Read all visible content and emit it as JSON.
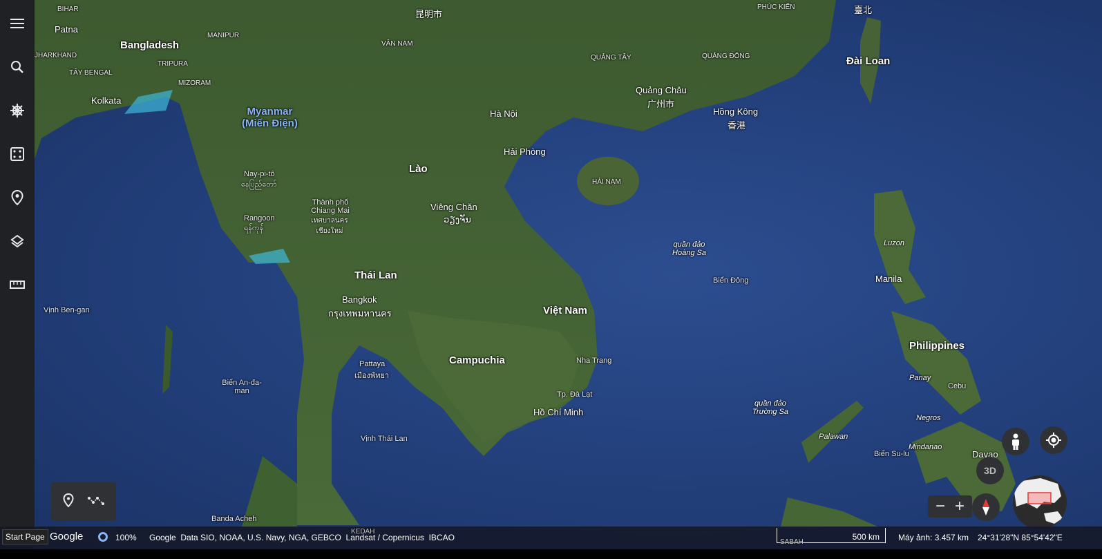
{
  "sidebar": {
    "items": [
      {
        "name": "menu"
      },
      {
        "name": "search"
      },
      {
        "name": "voyager"
      },
      {
        "name": "feeling-lucky"
      },
      {
        "name": "projects"
      },
      {
        "name": "map-style"
      },
      {
        "name": "measure"
      }
    ]
  },
  "map": {
    "countries": [
      "Bangladesh",
      "Lào",
      "Thái Lan",
      "Việt Nam",
      "Campuchia",
      "Philippines",
      "Đài Loan"
    ],
    "myanmar": [
      "Myanmar",
      "(Miến Điện)"
    ],
    "cities": [
      "Patna",
      "Kolkata",
      "Hà Nội",
      "Hải Phòng",
      "Viêng Chăn",
      "ວຽງຈັນ",
      "Bangkok",
      "กรุงเทพมหานคร",
      "Hồ Chí Minh",
      "Nha Trang",
      "Tp. Đà Lạt",
      "Manila",
      "Davao",
      "Quảng Châu",
      "广州市",
      "Hồng Kông",
      "香港",
      "臺北",
      "昆明市",
      "Nay-pi-tô",
      "နေပြည်တော်",
      "Rangoon",
      "ရန်ကုန်",
      "Thành phố Chiang Mai",
      "เทศบาลนครเชียงใหม่",
      "Pattaya",
      "เมืองพัทยา",
      "Cebu"
    ],
    "regions": [
      "BIHAR",
      "MANIPUR",
      "TRIPURA",
      "MIZORAM",
      "JHARKHAND",
      "TÂY BENGAL",
      "VÂN NAM",
      "QUẢNG TÂY",
      "QUẢNG ĐÔNG",
      "PHÚC KIẾN",
      "HẢI NAM",
      "KEDAH",
      "SABAH"
    ],
    "seas": [
      "Vịnh Ben-gan",
      "Biển An-đa-man",
      "Vịnh Thái Lan",
      "Biển Đông",
      "Biển Su-lu"
    ],
    "islands": [
      "quần đảo Hoàng Sa",
      "quần đảo Trường Sa",
      "Luzon",
      "Palawan",
      "Mindanao",
      "Panay",
      "Negros"
    ],
    "other": [
      "Banda Acheh"
    ]
  },
  "tools": {
    "placemark": "placemark-icon",
    "path": "path-icon"
  },
  "controls": {
    "three_d": "3D"
  },
  "status": {
    "start_page": "Start Page",
    "logo": "Google",
    "loading": "100%",
    "attribution": "Google  Data SIO, NOAA, U.S. Navy, NGA, GEBCO  Landsat / Copernicus  IBCAO",
    "scale": "500 km",
    "camera": "Máy ảnh: 3.457 km",
    "coords": "24°31'28\"N 85°54'42\"E"
  },
  "colors": {
    "ocean": "#23407c",
    "land": "#3e5e2e",
    "sidebar": "#202124",
    "accent": "#8ab4f8"
  }
}
